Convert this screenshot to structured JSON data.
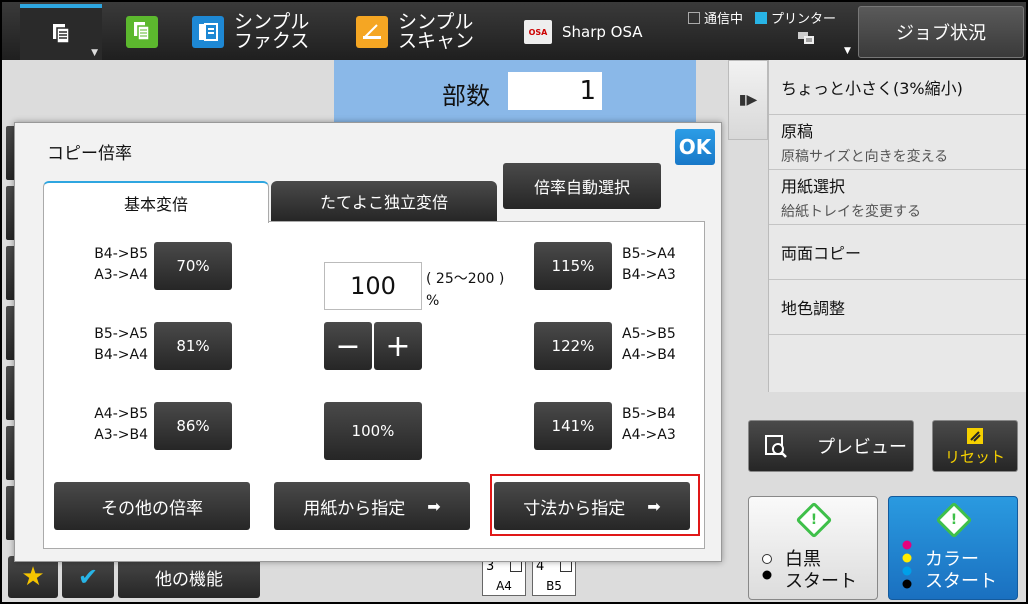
{
  "topbar": {
    "apps": [
      {
        "label1": "シンプル",
        "label2": "ファクス"
      },
      {
        "label1": "シンプル",
        "label2": "スキャン"
      },
      {
        "label1": "Sharp OSA"
      }
    ],
    "status": {
      "comm": "通信中",
      "printer": "プリンター"
    },
    "job_status": "ジョブ状況",
    "osa_logo_text": "OSA"
  },
  "copy_screen": {
    "copies_label": "部数",
    "copies_value": "1",
    "side_menu": [
      {
        "title": "ちょっと小さく(3%縮小)",
        "sub": ""
      },
      {
        "title": "原稿",
        "sub": "原稿サイズと向きを変える"
      },
      {
        "title": "用紙選択",
        "sub": "給紙トレイを変更する"
      },
      {
        "title": "両面コピー",
        "sub": ""
      },
      {
        "title": "地色調整",
        "sub": ""
      }
    ],
    "preview": "プレビュー",
    "reset": "リセット",
    "bw_start": {
      "line1": "白黒",
      "line2": "スタート"
    },
    "color_start": {
      "line1": "カラー",
      "line2": "スタート"
    },
    "other_functions": "他の機能",
    "trays": [
      {
        "num": "3",
        "size": "A4"
      },
      {
        "num": "4",
        "size": "B5"
      }
    ]
  },
  "dialog": {
    "title": "コピー倍率",
    "ok": "OK",
    "tabs": [
      "基本変倍",
      "たてよこ独立変倍"
    ],
    "auto_select": "倍率自動選択",
    "presets_left": [
      {
        "line1": "B4->B5",
        "line2": "A3->A4",
        "value": "70%"
      },
      {
        "line1": "B5->A5",
        "line2": "B4->A4",
        "value": "81%"
      },
      {
        "line1": "A4->B5",
        "line2": "A3->B4",
        "value": "86%"
      }
    ],
    "presets_right": [
      {
        "line1": "B5->A4",
        "line2": "B4->A3",
        "value": "115%"
      },
      {
        "line1": "A5->B5",
        "line2": "A4->B4",
        "value": "122%"
      },
      {
        "line1": "B5->B4",
        "line2": "A4->A3",
        "value": "141%"
      }
    ],
    "ratio_value": "100",
    "ratio_range": "( 25～200 )",
    "ratio_unit": "%",
    "minus": "−",
    "plus": "+",
    "reset_100": "100%",
    "other_ratio": "その他の倍率",
    "from_paper": "用紙から指定",
    "from_dimension": "寸法から指定"
  },
  "colors": {
    "accent": "#2ea6e0",
    "highlight": "#e01818",
    "copies_bg": "#8ab8e8",
    "start_color": "#1a70c0"
  }
}
